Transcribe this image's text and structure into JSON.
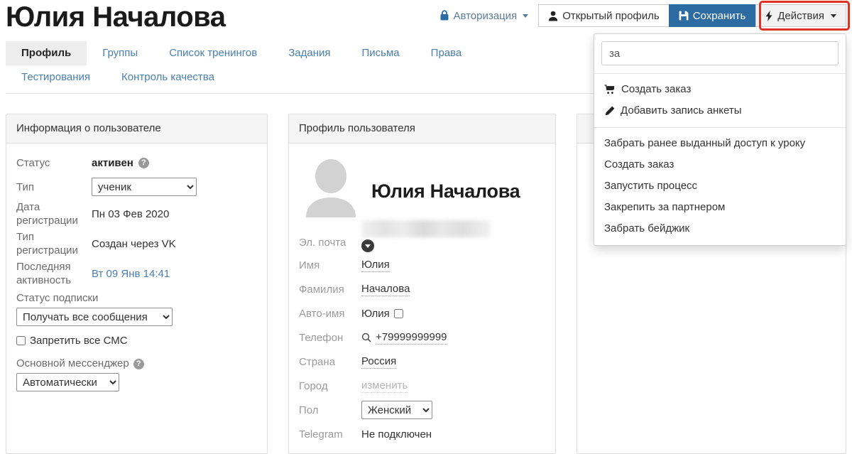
{
  "header": {
    "title": "Юлия Началова",
    "auth_label": "Авторизация",
    "auth_icon": "lock-icon",
    "open_profile_label": "Открытый профиль",
    "open_profile_icon": "user-icon",
    "save_label": "Сохранить",
    "save_icon": "floppy-disk-icon",
    "actions_label": "Действия",
    "actions_icon": "lightning-bolt-icon",
    "accent_primary": "#2d6ca2",
    "accent_link": "#4a7fae",
    "highlight_red": "#e03127"
  },
  "tabs": [
    {
      "label": "Профиль",
      "active": true
    },
    {
      "label": "Группы",
      "active": false
    },
    {
      "label": "Список тренингов",
      "active": false
    },
    {
      "label": "Задания",
      "active": false
    },
    {
      "label": "Письма",
      "active": false
    },
    {
      "label": "Права",
      "active": false
    },
    {
      "label": "Тестирования",
      "active": false
    },
    {
      "label": "Контроль качества",
      "active": false
    }
  ],
  "actions_menu": {
    "search_value": "за",
    "search_placeholder": "",
    "top_items": [
      {
        "label": "Создать заказ",
        "icon": "shopping-cart-icon"
      },
      {
        "label": "Добавить запись анкеты",
        "icon": "pencil-icon"
      }
    ],
    "bottom_items": [
      {
        "label": "Забрать ранее выданный доступ к уроку",
        "highlighted": false
      },
      {
        "label": "Создать заказ",
        "highlighted": false
      },
      {
        "label": "Запустить процесс",
        "highlighted": true
      },
      {
        "label": "Закрепить за партнером",
        "highlighted": false
      },
      {
        "label": "Забрать бейджик",
        "highlighted": false
      }
    ]
  },
  "user_info_panel": {
    "title": "Информация о пользователе",
    "status_label": "Статус",
    "status_value": "активен",
    "type_label": "Тип",
    "type_value": "ученик",
    "type_options": [
      "ученик"
    ],
    "reg_date_label": "Дата регистрации",
    "reg_date_value": "Пн 03 Фев 2020",
    "reg_type_label": "Тип регистрации",
    "reg_type_value": "Создан через VK",
    "last_activity_label": "Последняя активность",
    "last_activity_value": "Вт 09 Янв 14:41",
    "subscription_label": "Статус подписки",
    "subscription_value": "Получать все сообщения",
    "subscription_options": [
      "Получать все сообщения"
    ],
    "block_sms_label": "Запретить все СМС",
    "block_sms_checked": false,
    "messenger_label": "Основной мессенджер",
    "messenger_value": "Автоматически",
    "messenger_options": [
      "Автоматически"
    ]
  },
  "profile_panel": {
    "title": "Профиль пользователя",
    "display_name": "Юлия Началова",
    "avatar_icon": "avatar-placeholder-icon",
    "email_label": "Эл. почта",
    "email_value": "",
    "firstname_label": "Имя",
    "firstname_value": "Юлия",
    "lastname_label": "Фамилия",
    "lastname_value": "Началова",
    "autoname_label": "Авто-имя",
    "autoname_value": "Юлия",
    "autoname_checked": false,
    "phone_label": "Телефон",
    "phone_value": "+79999999999",
    "phone_icon": "search-icon",
    "country_label": "Страна",
    "country_value": "Россия",
    "city_label": "Город",
    "city_value": "изменить",
    "gender_label": "Пол",
    "gender_value": "Женский",
    "gender_options": [
      "Женский"
    ],
    "telegram_label": "Telegram",
    "telegram_value": "Не подключен"
  }
}
